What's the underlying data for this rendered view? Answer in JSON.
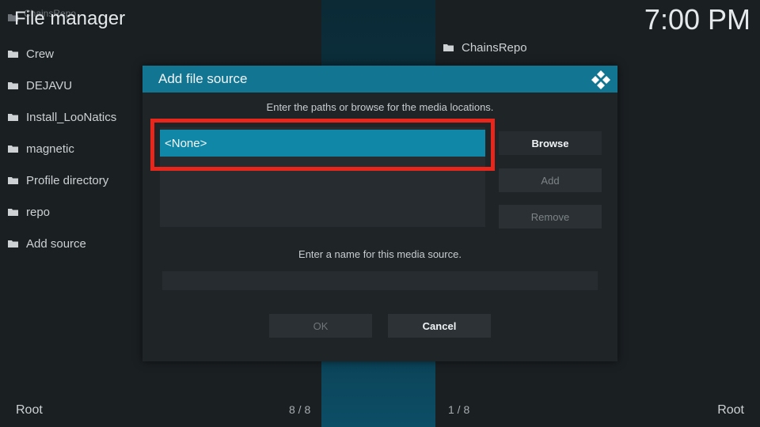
{
  "window": {
    "title": "File manager",
    "ghost_title": "ChainsRepo",
    "clock": "7:00 PM"
  },
  "left_list": {
    "items": [
      {
        "label": "Crew"
      },
      {
        "label": "DEJAVU"
      },
      {
        "label": "Install_LooNatics"
      },
      {
        "label": "magnetic"
      },
      {
        "label": "Profile directory"
      },
      {
        "label": "repo"
      },
      {
        "label": "Add source"
      }
    ]
  },
  "right_list": {
    "items": [
      {
        "label": "ChainsRepo"
      }
    ]
  },
  "footer": {
    "left_location": "Root",
    "left_count": "8 / 8",
    "right_count": "1 / 8",
    "right_location": "Root"
  },
  "dialog": {
    "title": "Add file source",
    "paths_instruction": "Enter the paths or browse for the media locations.",
    "path_entry": "<None>",
    "browse_label": "Browse",
    "add_label": "Add",
    "remove_label": "Remove",
    "name_instruction": "Enter a name for this media source.",
    "name_value": "",
    "ok_label": "OK",
    "cancel_label": "Cancel"
  },
  "colors": {
    "accent": "#127591",
    "selection": "#1187a8",
    "highlight_border": "#e8261c"
  },
  "icons": {
    "folder": "folder-icon",
    "kodi": "kodi-logo-icon"
  }
}
